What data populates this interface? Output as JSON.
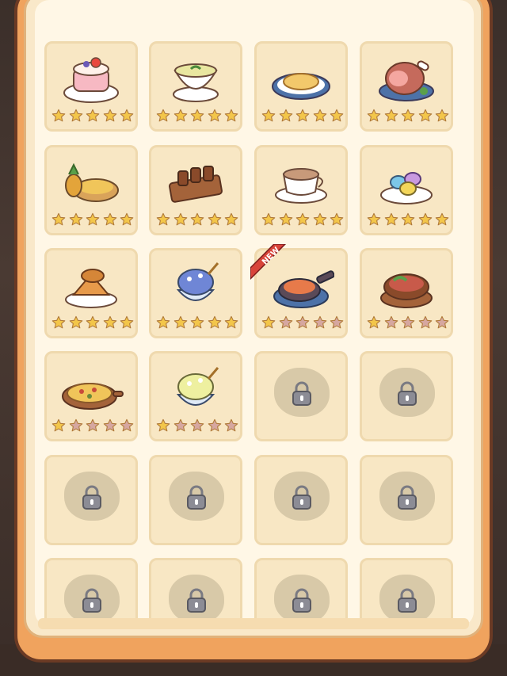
{
  "palette": {
    "star_filled": "#f3c64a",
    "star_empty": "#d6a7a0",
    "card_bg": "#f8e7c4",
    "frame": "#f0a35e"
  },
  "banner": {
    "icon": "blue-ribbon-banner"
  },
  "recipes": [
    {
      "name": "strawberry-cake",
      "unlocked": true,
      "stars": 5,
      "new": false
    },
    {
      "name": "soup-bowl",
      "unlocked": true,
      "stars": 5,
      "new": false
    },
    {
      "name": "omelette-plate",
      "unlocked": true,
      "stars": 5,
      "new": false
    },
    {
      "name": "roast-ham",
      "unlocked": true,
      "stars": 5,
      "new": false
    },
    {
      "name": "pineapple-pie",
      "unlocked": true,
      "stars": 5,
      "new": false
    },
    {
      "name": "skewers",
      "unlocked": true,
      "stars": 5,
      "new": false
    },
    {
      "name": "latte-cup",
      "unlocked": true,
      "stars": 5,
      "new": false
    },
    {
      "name": "macarons",
      "unlocked": true,
      "stars": 5,
      "new": false
    },
    {
      "name": "fruit-tart",
      "unlocked": true,
      "stars": 5,
      "new": false
    },
    {
      "name": "blueberry-shaved-ice",
      "unlocked": true,
      "stars": 5,
      "new": false
    },
    {
      "name": "seafood-pot",
      "unlocked": true,
      "stars": 1,
      "new": true
    },
    {
      "name": "stew-pot",
      "unlocked": true,
      "stars": 1,
      "new": false
    },
    {
      "name": "pizza",
      "unlocked": true,
      "stars": 1,
      "new": false
    },
    {
      "name": "melon-shaved-ice",
      "unlocked": true,
      "stars": 1,
      "new": false
    },
    {
      "name": "locked",
      "unlocked": false
    },
    {
      "name": "locked",
      "unlocked": false
    },
    {
      "name": "locked",
      "unlocked": false
    },
    {
      "name": "locked",
      "unlocked": false
    },
    {
      "name": "locked",
      "unlocked": false
    },
    {
      "name": "locked",
      "unlocked": false
    },
    {
      "name": "locked",
      "unlocked": false
    },
    {
      "name": "locked",
      "unlocked": false
    },
    {
      "name": "locked",
      "unlocked": false
    },
    {
      "name": "locked",
      "unlocked": false
    }
  ],
  "new_badge_text": "NEW"
}
